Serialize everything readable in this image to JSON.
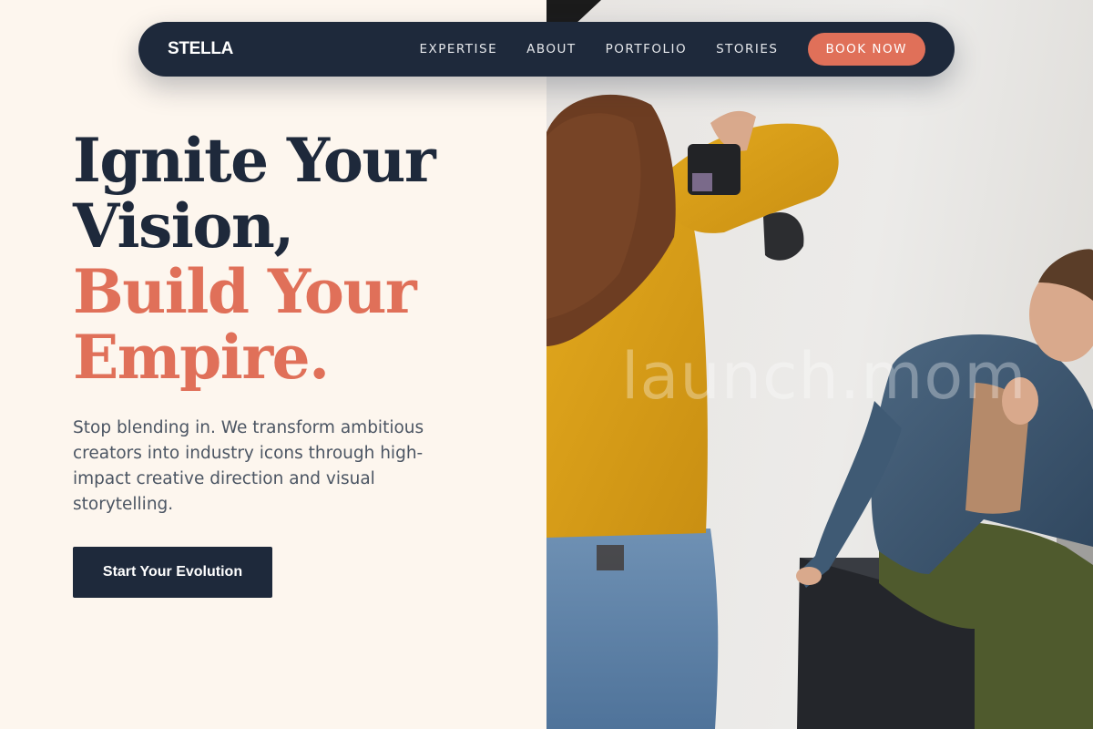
{
  "nav": {
    "brand": "STELLA",
    "links": [
      "EXPERTISE",
      "ABOUT",
      "PORTFOLIO",
      "STORIES"
    ],
    "cta": "BOOK NOW"
  },
  "hero": {
    "headline_dark": [
      "Ignite Your",
      "Vision,"
    ],
    "headline_accent": [
      "Build Your",
      "Empire."
    ],
    "subtext": "Stop blending in. We transform ambitious creators into industry icons through high-impact creative direction and visual storytelling.",
    "cta": "Start Your Evolution"
  },
  "photo": {
    "subject": "photographer-shooting-model-photo",
    "watermark": "launch.mom"
  },
  "colors": {
    "navy": "#1e293b",
    "accent": "#e07059",
    "background": "#fdf6ee",
    "body_text": "#4b5563"
  }
}
